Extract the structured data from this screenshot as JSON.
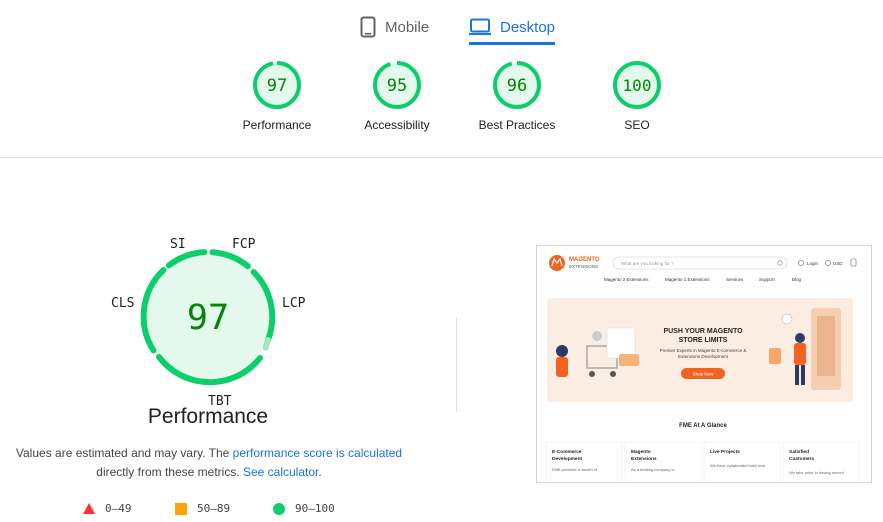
{
  "tabs": [
    {
      "label": "Mobile",
      "icon": "mobile-phone-icon",
      "active": false
    },
    {
      "label": "Desktop",
      "icon": "desktop-monitor-icon",
      "active": true
    }
  ],
  "summary_scores": [
    {
      "value": "97",
      "label": "Performance"
    },
    {
      "value": "95",
      "label": "Accessibility"
    },
    {
      "value": "96",
      "label": "Best Practices"
    },
    {
      "value": "100",
      "label": "SEO"
    }
  ],
  "performance": {
    "score": "97",
    "title": "Performance",
    "metrics": {
      "si": "SI",
      "fcp": "FCP",
      "lcp": "LCP",
      "tbt": "TBT",
      "cls": "CLS"
    }
  },
  "note": {
    "prefix": "Values are estimated and may vary. The ",
    "link1": "performance score is calculated",
    "middle": "directly from these metrics. ",
    "link2": "See calculator",
    "suffix": "."
  },
  "legend": [
    {
      "range": "0–49",
      "icon": "red-triangle-icon"
    },
    {
      "range": "50–89",
      "icon": "orange-square-icon"
    },
    {
      "range": "90–100",
      "icon": "green-circle-icon"
    }
  ],
  "colors": {
    "pass": "#0cce6b",
    "pass_text": "#008800",
    "pass_bg": "#e5f8ee",
    "fail": "#ff3333",
    "average": "#ffa400",
    "link": "#1a73e8"
  },
  "screenshot": {
    "logo_top": "MAGENTO",
    "logo_bottom": "EXTENSIONS",
    "search_placeholder": "What are you looking for ?",
    "login": "Login",
    "currency": "USD",
    "nav": [
      "Magento 2 Extensions",
      "Magento 1 Extensions",
      "Services",
      "Support",
      "Blog"
    ],
    "hero_title_1": "PUSH YOUR MAGENTO",
    "hero_title_2": "STORE LIMITS",
    "hero_sub_1": "Premier Experts in Magento E-commerce &",
    "hero_sub_2": "Extensions Development",
    "hero_button": "Shop Now",
    "section_title": "FME At A Glance",
    "cards": [
      {
        "title_1": "E-Commerce",
        "title_2": "Development",
        "body": "FME provides a wealth of"
      },
      {
        "title_1": "Magento",
        "title_2": "Extensions",
        "body": "As a leading company in"
      },
      {
        "title_1": "Live Projects",
        "title_2": "",
        "body": "We have collaborated with over"
      },
      {
        "title_1": "Satisfied",
        "title_2": "Customers",
        "body": "We take pride in having served"
      }
    ]
  }
}
